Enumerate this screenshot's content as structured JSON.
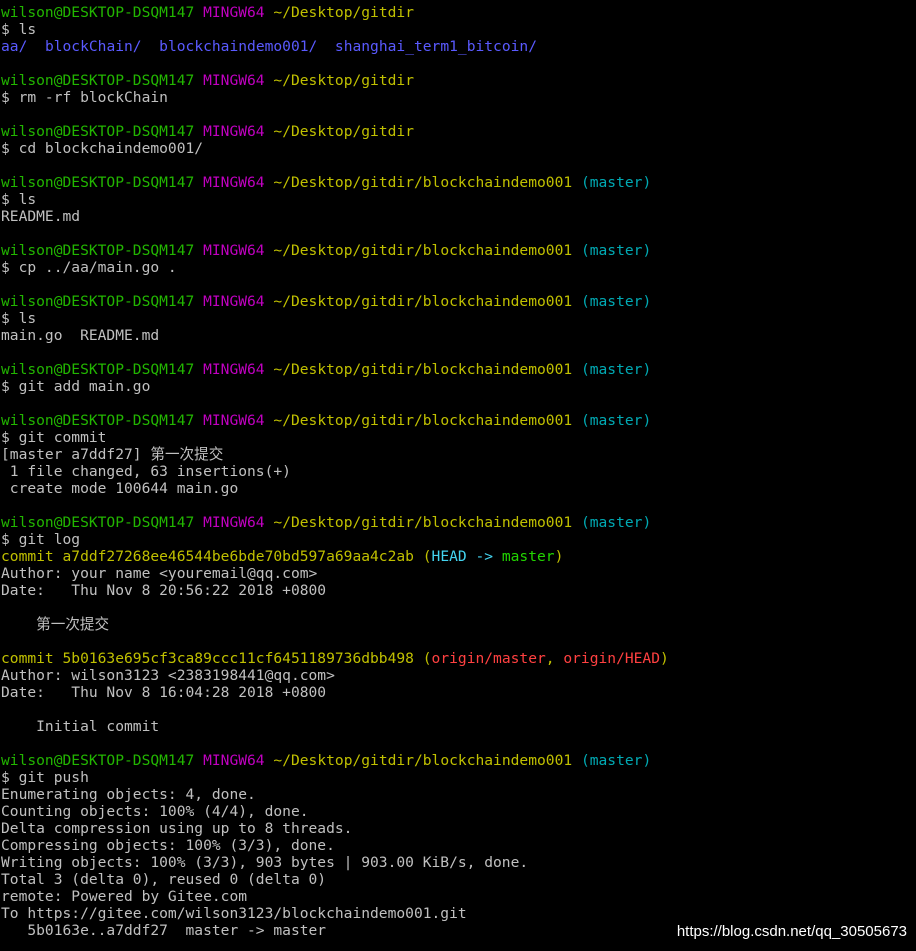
{
  "colors": {
    "background": "#000000",
    "text": "#c0c0c0",
    "prompt_user": "#22b600",
    "prompt_system": "#c000c0",
    "prompt_path": "#c0c000",
    "branch": "#00aab4",
    "dir_listing": "#5a5aff",
    "commit_hash": "#c0c000",
    "head_ref": "#44d4f0",
    "local_branch": "#22d400",
    "remote_ref": "#ff4040",
    "watermark": "#ffffff"
  },
  "lines": [
    {
      "type": "prompt",
      "user": "wilson@DESKTOP-DSQM147",
      "system": "MINGW64",
      "path": "~/Desktop/gitdir",
      "branch": ""
    },
    {
      "type": "text",
      "segments": [
        {
          "text": "$ ls",
          "color": "text"
        }
      ]
    },
    {
      "type": "text",
      "segments": [
        {
          "text": "aa/",
          "color": "dir_listing"
        },
        {
          "text": "  ",
          "color": "text"
        },
        {
          "text": "blockChain/",
          "color": "dir_listing"
        },
        {
          "text": "  ",
          "color": "text"
        },
        {
          "text": "blockchaindemo001/",
          "color": "dir_listing"
        },
        {
          "text": "  ",
          "color": "text"
        },
        {
          "text": "shanghai_term1_bitcoin/",
          "color": "dir_listing"
        }
      ]
    },
    {
      "type": "blank"
    },
    {
      "type": "prompt",
      "user": "wilson@DESKTOP-DSQM147",
      "system": "MINGW64",
      "path": "~/Desktop/gitdir",
      "branch": ""
    },
    {
      "type": "text",
      "segments": [
        {
          "text": "$ rm -rf blockChain",
          "color": "text"
        }
      ]
    },
    {
      "type": "blank"
    },
    {
      "type": "prompt",
      "user": "wilson@DESKTOP-DSQM147",
      "system": "MINGW64",
      "path": "~/Desktop/gitdir",
      "branch": ""
    },
    {
      "type": "text",
      "segments": [
        {
          "text": "$ cd blockchaindemo001/",
          "color": "text"
        }
      ]
    },
    {
      "type": "blank"
    },
    {
      "type": "prompt",
      "user": "wilson@DESKTOP-DSQM147",
      "system": "MINGW64",
      "path": "~/Desktop/gitdir/blockchaindemo001",
      "branch": "(master)"
    },
    {
      "type": "text",
      "segments": [
        {
          "text": "$ ls",
          "color": "text"
        }
      ]
    },
    {
      "type": "text",
      "segments": [
        {
          "text": "README.md",
          "color": "text"
        }
      ]
    },
    {
      "type": "blank"
    },
    {
      "type": "prompt",
      "user": "wilson@DESKTOP-DSQM147",
      "system": "MINGW64",
      "path": "~/Desktop/gitdir/blockchaindemo001",
      "branch": "(master)"
    },
    {
      "type": "text",
      "segments": [
        {
          "text": "$ cp ../aa/main.go .",
          "color": "text"
        }
      ]
    },
    {
      "type": "blank"
    },
    {
      "type": "prompt",
      "user": "wilson@DESKTOP-DSQM147",
      "system": "MINGW64",
      "path": "~/Desktop/gitdir/blockchaindemo001",
      "branch": "(master)"
    },
    {
      "type": "text",
      "segments": [
        {
          "text": "$ ls",
          "color": "text"
        }
      ]
    },
    {
      "type": "text",
      "segments": [
        {
          "text": "main.go  README.md",
          "color": "text"
        }
      ]
    },
    {
      "type": "blank"
    },
    {
      "type": "prompt",
      "user": "wilson@DESKTOP-DSQM147",
      "system": "MINGW64",
      "path": "~/Desktop/gitdir/blockchaindemo001",
      "branch": "(master)"
    },
    {
      "type": "text",
      "segments": [
        {
          "text": "$ git add main.go",
          "color": "text"
        }
      ]
    },
    {
      "type": "blank"
    },
    {
      "type": "prompt",
      "user": "wilson@DESKTOP-DSQM147",
      "system": "MINGW64",
      "path": "~/Desktop/gitdir/blockchaindemo001",
      "branch": "(master)"
    },
    {
      "type": "text",
      "segments": [
        {
          "text": "$ git commit",
          "color": "text"
        }
      ]
    },
    {
      "type": "text",
      "segments": [
        {
          "text": "[master a7ddf27] 第一次提交",
          "color": "text"
        }
      ]
    },
    {
      "type": "text",
      "segments": [
        {
          "text": " 1 file changed, 63 insertions(+)",
          "color": "text"
        }
      ]
    },
    {
      "type": "text",
      "segments": [
        {
          "text": " create mode 100644 main.go",
          "color": "text"
        }
      ]
    },
    {
      "type": "blank"
    },
    {
      "type": "prompt",
      "user": "wilson@DESKTOP-DSQM147",
      "system": "MINGW64",
      "path": "~/Desktop/gitdir/blockchaindemo001",
      "branch": "(master)"
    },
    {
      "type": "text",
      "segments": [
        {
          "text": "$ git log",
          "color": "text"
        }
      ]
    },
    {
      "type": "text",
      "segments": [
        {
          "text": "commit a7ddf27268ee46544be6bde70bd597a69aa4c2ab ",
          "color": "commit_hash"
        },
        {
          "text": "(",
          "color": "commit_hash"
        },
        {
          "text": "HEAD -> ",
          "color": "head_ref"
        },
        {
          "text": "master",
          "color": "local_branch"
        },
        {
          "text": ")",
          "color": "commit_hash"
        }
      ]
    },
    {
      "type": "text",
      "segments": [
        {
          "text": "Author: your name <youremail@qq.com>",
          "color": "text"
        }
      ]
    },
    {
      "type": "text",
      "segments": [
        {
          "text": "Date:   Thu Nov 8 20:56:22 2018 +0800",
          "color": "text"
        }
      ]
    },
    {
      "type": "blank"
    },
    {
      "type": "text",
      "segments": [
        {
          "text": "    第一次提交",
          "color": "text"
        }
      ]
    },
    {
      "type": "blank"
    },
    {
      "type": "text",
      "segments": [
        {
          "text": "commit 5b0163e695cf3ca89ccc11cf6451189736dbb498 ",
          "color": "commit_hash"
        },
        {
          "text": "(",
          "color": "commit_hash"
        },
        {
          "text": "origin/master",
          "color": "remote_ref"
        },
        {
          "text": ", ",
          "color": "commit_hash"
        },
        {
          "text": "origin/HEAD",
          "color": "remote_ref"
        },
        {
          "text": ")",
          "color": "commit_hash"
        }
      ]
    },
    {
      "type": "text",
      "segments": [
        {
          "text": "Author: wilson3123 <2383198441@qq.com>",
          "color": "text"
        }
      ]
    },
    {
      "type": "text",
      "segments": [
        {
          "text": "Date:   Thu Nov 8 16:04:28 2018 +0800",
          "color": "text"
        }
      ]
    },
    {
      "type": "blank"
    },
    {
      "type": "text",
      "segments": [
        {
          "text": "    Initial commit",
          "color": "text"
        }
      ]
    },
    {
      "type": "blank"
    },
    {
      "type": "prompt",
      "user": "wilson@DESKTOP-DSQM147",
      "system": "MINGW64",
      "path": "~/Desktop/gitdir/blockchaindemo001",
      "branch": "(master)"
    },
    {
      "type": "text",
      "segments": [
        {
          "text": "$ git push",
          "color": "text"
        }
      ]
    },
    {
      "type": "text",
      "segments": [
        {
          "text": "Enumerating objects: 4, done.",
          "color": "text"
        }
      ]
    },
    {
      "type": "text",
      "segments": [
        {
          "text": "Counting objects: 100% (4/4), done.",
          "color": "text"
        }
      ]
    },
    {
      "type": "text",
      "segments": [
        {
          "text": "Delta compression using up to 8 threads.",
          "color": "text"
        }
      ]
    },
    {
      "type": "text",
      "segments": [
        {
          "text": "Compressing objects: 100% (3/3), done.",
          "color": "text"
        }
      ]
    },
    {
      "type": "text",
      "segments": [
        {
          "text": "Writing objects: 100% (3/3), 903 bytes | 903.00 KiB/s, done.",
          "color": "text"
        }
      ]
    },
    {
      "type": "text",
      "segments": [
        {
          "text": "Total 3 (delta 0), reused 0 (delta 0)",
          "color": "text"
        }
      ]
    },
    {
      "type": "text",
      "segments": [
        {
          "text": "remote: Powered by Gitee.com",
          "color": "text"
        }
      ]
    },
    {
      "type": "text",
      "segments": [
        {
          "text": "To https://gitee.com/wilson3123/blockchaindemo001.git",
          "color": "text"
        }
      ]
    },
    {
      "type": "text",
      "segments": [
        {
          "text": "   5b0163e..a7ddf27  master -> master",
          "color": "text"
        }
      ]
    }
  ],
  "watermark": "https://blog.csdn.net/qq_30505673"
}
